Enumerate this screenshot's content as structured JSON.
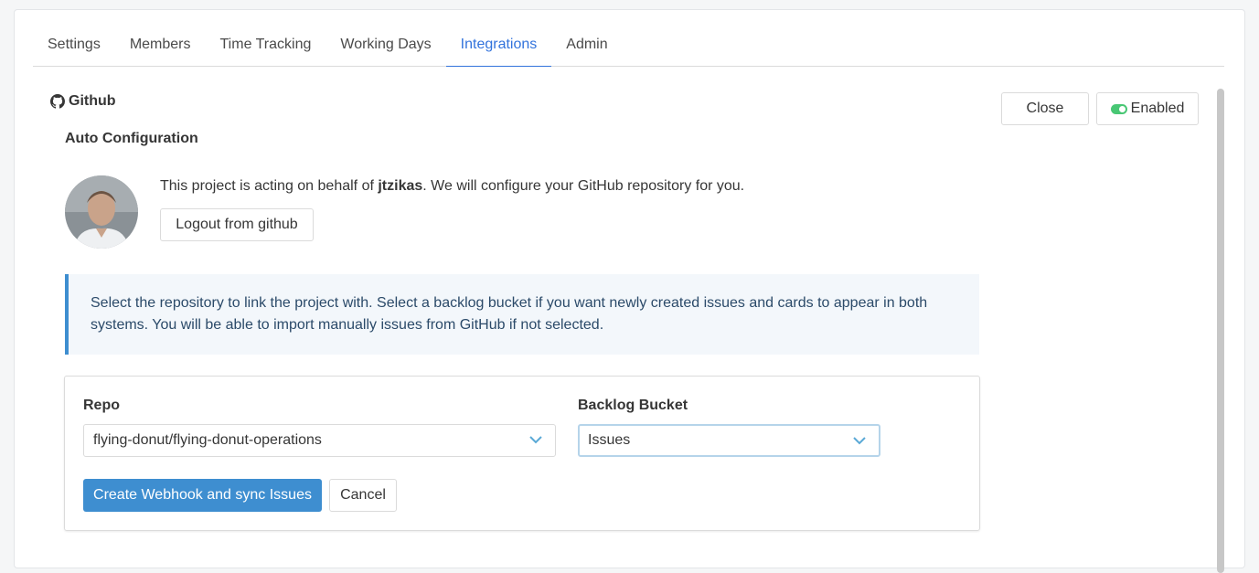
{
  "tabs": [
    {
      "label": "Settings"
    },
    {
      "label": "Members"
    },
    {
      "label": "Time Tracking"
    },
    {
      "label": "Working Days"
    },
    {
      "label": "Integrations",
      "active": true
    },
    {
      "label": "Admin"
    }
  ],
  "integration": {
    "title": "Github",
    "icon": "github-icon",
    "close_label": "Close",
    "enabled_label": "Enabled",
    "enabled": true
  },
  "auto_config": {
    "title": "Auto Configuration",
    "acting_prefix": "This project is acting on behalf of ",
    "username": "jtzikas",
    "acting_suffix": ". We will configure your GitHub repository for you.",
    "logout_label": "Logout from github"
  },
  "notice": {
    "text": "Select the repository to link the project with. Select a backlog bucket if you want newly created issues and cards to appear in both systems. You will be able to import manually issues from GitHub if not selected."
  },
  "form": {
    "repo_label": "Repo",
    "repo_value": "flying-donut/flying-donut-operations",
    "bucket_label": "Backlog Bucket",
    "bucket_value": "Issues",
    "submit_label": "Create Webhook and sync Issues",
    "cancel_label": "Cancel"
  },
  "colors": {
    "accent": "#3273dc",
    "primary": "#3e8ed0",
    "toggle_on": "#48c774"
  }
}
